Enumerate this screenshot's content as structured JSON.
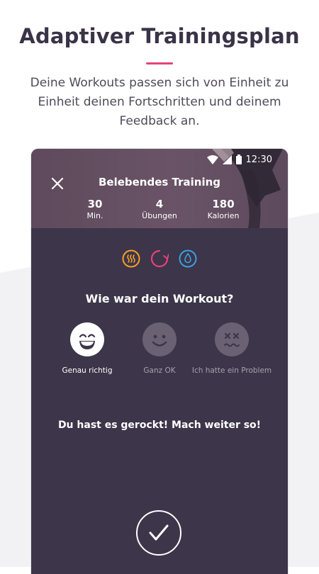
{
  "promo": {
    "title": "Adaptiver Trainingsplan",
    "description": "Deine Workouts passen sich von Einheit zu Einheit deinen Fortschritten und deinem Feedback an."
  },
  "status_bar": {
    "time": "12:30"
  },
  "workout": {
    "title": "Belebendes Training",
    "stats": [
      {
        "value": "30",
        "label": "Min."
      },
      {
        "value": "4",
        "label": "Übungen"
      },
      {
        "value": "180",
        "label": "Kalorien"
      }
    ]
  },
  "category_icons": [
    {
      "name": "heat-icon",
      "color": "#f4a024"
    },
    {
      "name": "refresh-icon",
      "color": "#e8417c"
    },
    {
      "name": "water-drop-icon",
      "color": "#3aa0e0"
    }
  ],
  "feedback": {
    "question": "Wie war dein Workout?",
    "options": [
      {
        "label": "Genau richtig",
        "icon": "grinning-face-icon",
        "selected": true
      },
      {
        "label": "Ganz OK",
        "icon": "smiling-face-icon",
        "selected": false
      },
      {
        "label": "Ich hatte ein Problem",
        "icon": "dizzy-face-icon",
        "selected": false
      }
    ],
    "message": "Du hast es gerockt! Mach weiter so!"
  },
  "colors": {
    "accent": "#e8417c",
    "panel": "#3d3549",
    "headline": "#3a3347"
  }
}
